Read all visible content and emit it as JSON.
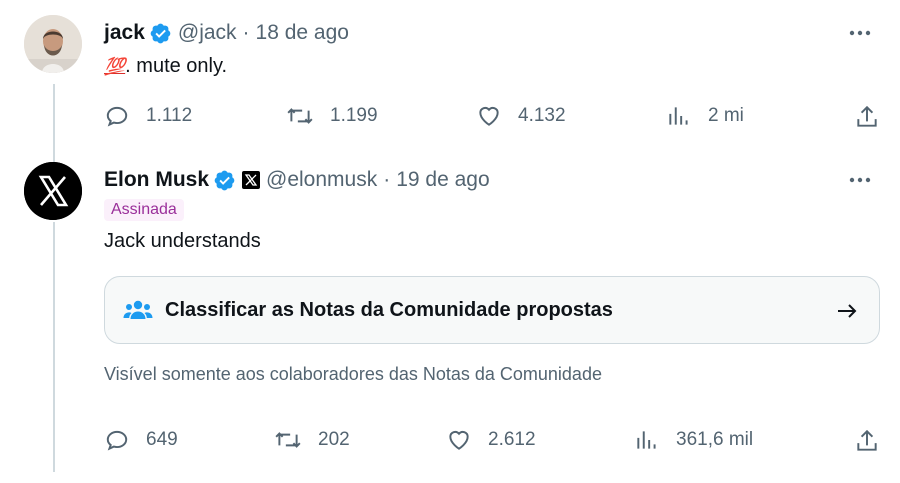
{
  "tweets": [
    {
      "name": "jack",
      "handle": "@jack",
      "separator": "·",
      "date": "18 de ago",
      "emoji": "💯",
      "text": ". mute only.",
      "stats": {
        "replies": "1.112",
        "reposts": "1.199",
        "likes": "4.132",
        "views": "2 mi"
      }
    },
    {
      "name": "Elon Musk",
      "handle": "@elonmusk",
      "separator": "·",
      "date": "19 de ago",
      "badge": "Assinada",
      "text": "Jack understands",
      "community_notes": {
        "action_label": "Classificar as Notas da Comunidade propostas",
        "visibility": "Visível somente aos colaboradores das Notas da Comunidade"
      },
      "stats": {
        "replies": "649",
        "reposts": "202",
        "likes": "2.612",
        "views": "361,6 mil"
      }
    }
  ],
  "colors": {
    "verified": "#1d9bf0",
    "secondary_text": "#536471",
    "badge_bg": "#fbf0fb",
    "badge_text": "#9a2f9a"
  },
  "icons": [
    "more-icon",
    "reply-icon",
    "repost-icon",
    "like-icon",
    "views-icon",
    "share-icon",
    "verified-icon",
    "community-icon",
    "arrow-right-icon",
    "x-logo-icon"
  ]
}
